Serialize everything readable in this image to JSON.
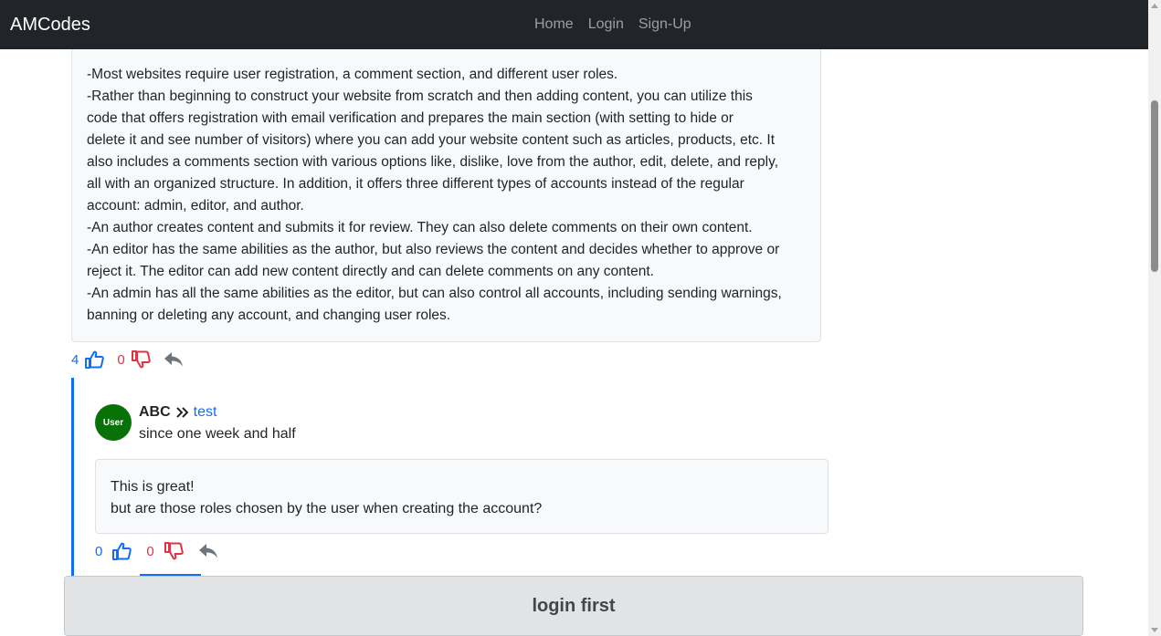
{
  "navbar": {
    "brand": "AMCodes",
    "links": [
      "Home",
      "Login",
      "Sign-Up"
    ]
  },
  "post": {
    "lines": [
      "-Most websites require user registration, a comment section, and different user roles.",
      "-Rather than beginning to construct your website from scratch and then adding content, you can utilize this",
      "code that offers registration with email verification and prepares the main section (with setting to hide or",
      "delete it and see number of visitors) where you can add your website content such as articles, products, etc. It",
      "also includes a comments section with various options like, dislike, love from the author, edit, delete, and reply,",
      "all with an organized structure. In addition, it offers three different types of accounts instead of the regular",
      "account: admin, editor, and author.",
      "-An author creates content and submits it for review. They can also delete comments on their own content.",
      "-An editor has the same abilities as the author, but also reviews the content and decides whether to approve or",
      "reject it. The editor can add new content directly and can delete comments on any content.",
      "-An admin has all the same abilities as the editor, but can also control all accounts, including sending warnings,",
      "banning or deleting any account, and changing user roles."
    ],
    "likes": "4",
    "dislikes": "0"
  },
  "comment": {
    "avatar_label": "User",
    "author": "ABC",
    "reply_to": "test",
    "time": "since one week and half",
    "lines": [
      "This is great!",
      "but are those roles chosen by the user when creating the account?"
    ],
    "likes": "0",
    "dislikes": "0"
  },
  "footer": {
    "login_text": "login first"
  },
  "colors": {
    "navbar": "#212529",
    "like": "#0d6efd",
    "dislike": "#dc3545",
    "avatar": "#087108",
    "reply_icon": "#6c757d"
  },
  "icons": [
    "thumbs-up-icon",
    "thumbs-down-icon",
    "reply-icon",
    "double-chevron-right-icon"
  ]
}
